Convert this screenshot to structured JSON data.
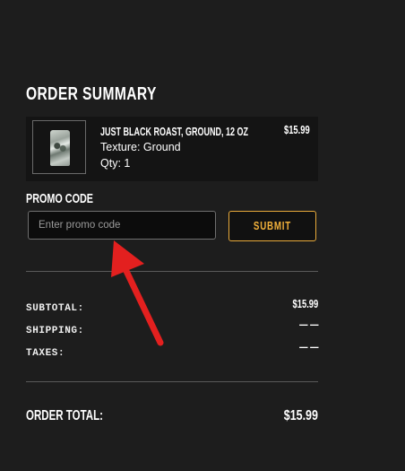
{
  "order_summary": {
    "title": "ORDER SUMMARY",
    "item": {
      "name": "JUST BLACK ROAST, GROUND, 12 OZ",
      "texture": "Texture: Ground",
      "qty": "Qty: 1",
      "price": "$15.99"
    }
  },
  "promo": {
    "label": "PROMO CODE",
    "input_value": "",
    "placeholder": "Enter promo code",
    "submit_label": "SUBMIT"
  },
  "totals": {
    "subtotal_label": "SUBTOTAL:",
    "subtotal_value": "$15.99",
    "shipping_label": "SHIPPING:",
    "shipping_value": "— —",
    "taxes_label": "TAXES:",
    "taxes_value": "— —",
    "order_total_label": "ORDER TOTAL:",
    "order_total_value": "$15.99"
  },
  "colors": {
    "background": "#1d1d1d",
    "accent": "#f2b13b",
    "annotation_arrow": "#e3201f"
  }
}
